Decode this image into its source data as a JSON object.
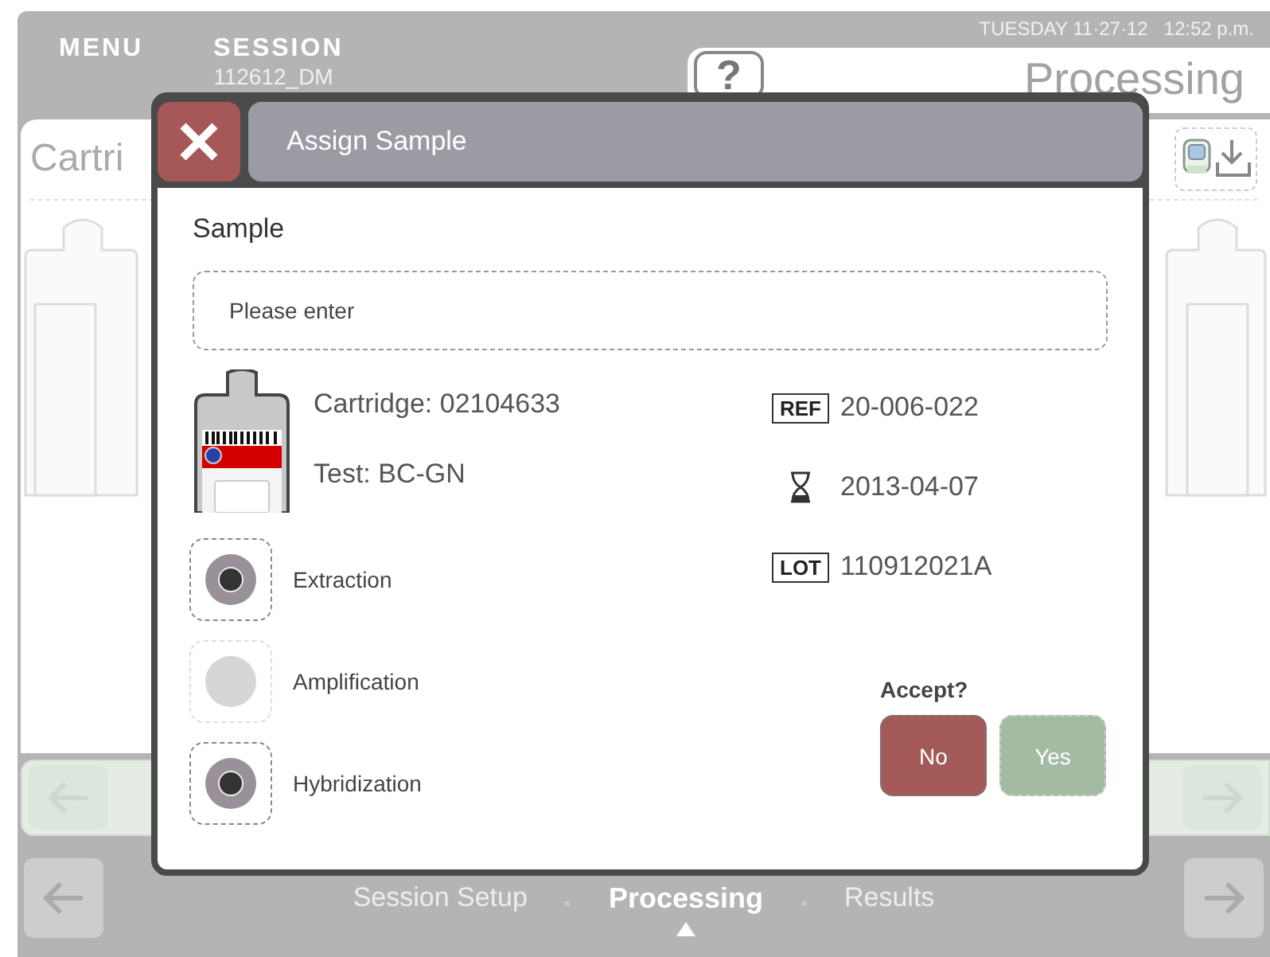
{
  "header": {
    "menu": "MENU",
    "session_label": "SESSION",
    "session_id": "112612_DM",
    "datetime": "TUESDAY 11·27·12   12:52 p.m.",
    "help": "?",
    "page_title": "Processing"
  },
  "panel": {
    "title": "Cartri"
  },
  "nav": {
    "steps": [
      {
        "label": "Session Setup",
        "selected": false
      },
      {
        "label": "Processing",
        "selected": true
      },
      {
        "label": "Results",
        "selected": false
      }
    ]
  },
  "dialog": {
    "title": "Assign Sample",
    "sample_label": "Sample",
    "sample_placeholder": "Please enter",
    "cartridge": "Cartridge: 02104633",
    "test": "Test: BC-GN",
    "details": [
      {
        "kind": "ref",
        "badge": "REF",
        "value": "20-006-022"
      },
      {
        "kind": "expiry",
        "value": "2013-04-07"
      },
      {
        "kind": "lot",
        "badge": "LOT",
        "value": "110912021A"
      }
    ],
    "steps": [
      {
        "label": "Extraction",
        "checked": true
      },
      {
        "label": "Amplification",
        "checked": false
      },
      {
        "label": "Hybridization",
        "checked": true
      }
    ],
    "accept_question": "Accept?",
    "buttons": [
      {
        "label": "No",
        "disabled": false
      },
      {
        "label": "Yes",
        "disabled": true
      }
    ]
  }
}
